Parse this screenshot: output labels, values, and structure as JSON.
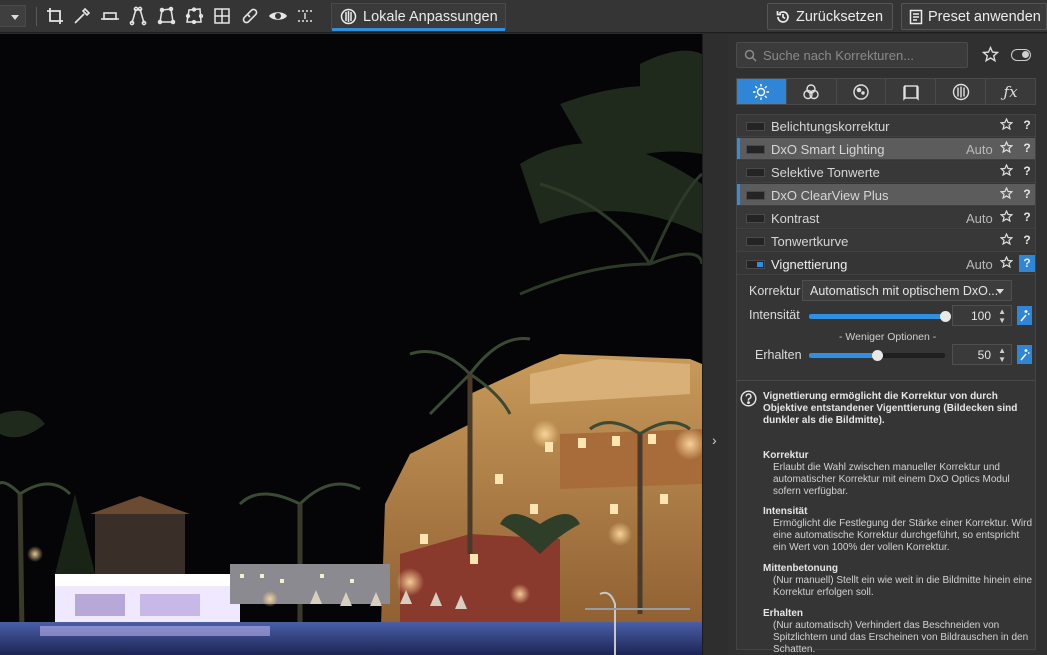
{
  "toolbar": {
    "tools": [
      "crop-icon",
      "color-picker-icon",
      "horizon-icon",
      "perspective-icon",
      "perspective-rect-icon",
      "perspective-8-icon",
      "grid-transform-icon",
      "repair-icon",
      "eye-icon",
      "guides-icon"
    ],
    "local_adjust_label": "Lokale Anpassungen",
    "reset_label": "Zurücksetzen",
    "apply_preset_label": "Preset anwenden"
  },
  "panel": {
    "search_placeholder": "Suche nach Korrekturen...",
    "category_tabs": [
      "light",
      "color",
      "detail",
      "geometry",
      "local",
      "fx"
    ],
    "rows": [
      {
        "label": "Belichtungskorrektur",
        "auto": "",
        "highlighted": false,
        "enabled": false
      },
      {
        "label": "DxO Smart Lighting",
        "auto": "Auto",
        "highlighted": true,
        "enabled": false
      },
      {
        "label": "Selektive Tonwerte",
        "auto": "",
        "highlighted": false,
        "enabled": false
      },
      {
        "label": "DxO ClearView Plus",
        "auto": "",
        "highlighted": true,
        "enabled": false
      },
      {
        "label": "Kontrast",
        "auto": "Auto",
        "highlighted": false,
        "enabled": false
      },
      {
        "label": "Tonwertkurve",
        "auto": "",
        "highlighted": false,
        "enabled": false
      },
      {
        "label": "Vignettierung",
        "auto": "Auto",
        "highlighted": false,
        "enabled": true
      }
    ],
    "help_glyph": "?",
    "vignette": {
      "korrektur_label": "Korrektur",
      "korrektur_value": "Automatisch mit optischem DxO...",
      "intensitaet_label": "Intensität",
      "intensitaet_value": "100",
      "intensitaet_fraction": 1.0,
      "less_options": "- Weniger Optionen -",
      "erhalten_label": "Erhalten",
      "erhalten_value": "50",
      "erhalten_fraction": 0.5
    },
    "help": {
      "intro": "Vignettierung ermöglicht die Korrektur von durch Objektive entstandener Vigenttierung (Bildecken sind dunkler als die Bildmitte).",
      "sections": [
        {
          "title": "Korrektur",
          "text": "Erlaubt die Wahl zwischen manueller Korrektur und automatischer Korrektur mit einem DxO Optics Modul sofern verfügbar."
        },
        {
          "title": "Intensität",
          "text": "Ermöglicht die Festlegung der Stärke einer Korrektur. Wird eine automatische Korrektur durchgeführt, so entspricht ein Wert von 100% der vollen Korrektur."
        },
        {
          "title": "Mittenbetonung",
          "text": "(Nur manuell) Stellt ein wie weit in die Bildmitte hinein eine Korrektur erfolgen soll."
        },
        {
          "title": "Erhalten",
          "text": "(Nur automatisch) Verhindert das Beschneiden von Spitzlichtern und das Erscheinen von Bildrauschen in den Schatten."
        }
      ]
    }
  },
  "colors": {
    "accent": "#2f8fe0",
    "panel": "#303030",
    "toolbar": "#353535"
  }
}
